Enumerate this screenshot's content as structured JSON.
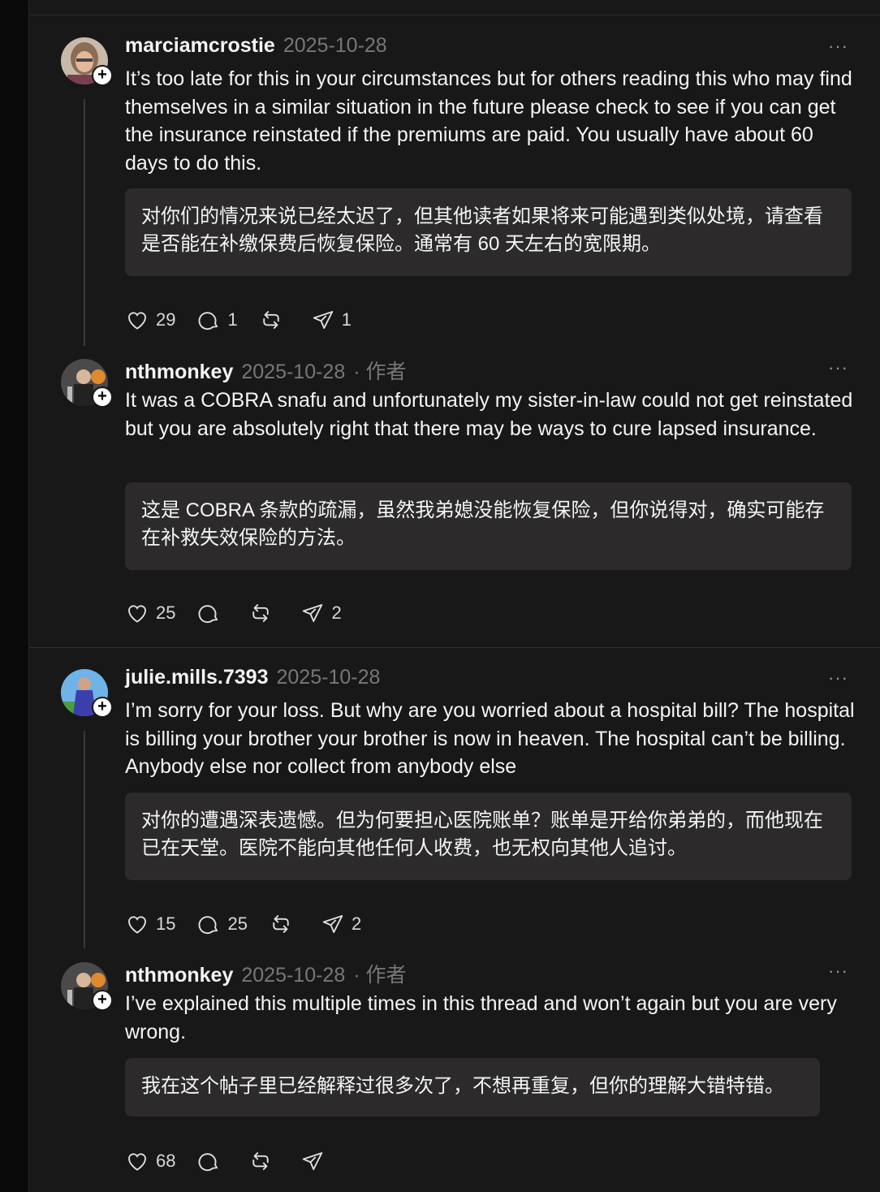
{
  "posts": [
    {
      "username": "marciamcrostie",
      "date": "2025-10-28",
      "author_tag": "",
      "more": "···",
      "text": "It’s too late for this in your circumstances but for others reading this who may find themselves in a similar situation in the future please check to see if you can get the insurance reinstated if the premiums are paid. You usually have about 60 days to do this.",
      "translation": "对你们的情况来说已经太迟了，但其他读者如果将来可能遇到类似处境，请查看是否能在补缴保费后恢复保险。通常有 60 天左右的宽限期。",
      "likes": "29",
      "replies": "1",
      "reposts": "",
      "shares": "1"
    },
    {
      "username": "nthmonkey",
      "date": "2025-10-28",
      "author_tag": "· 作者",
      "more": "···",
      "text": "It was a COBRA snafu and unfortunately my sister-in-law could not get reinstated but you are absolutely right that there may be ways to cure lapsed insurance.",
      "translation": "这是 COBRA 条款的疏漏，虽然我弟媳没能恢复保险，但你说得对，确实可能存在补救失效保险的方法。",
      "likes": "25",
      "replies": "",
      "reposts": "",
      "shares": "2"
    },
    {
      "username": "julie.mills.7393",
      "date": "2025-10-28",
      "author_tag": "",
      "more": "···",
      "text": "I’m sorry for your loss. But why are you worried about a hospital bill? The hospital is billing your brother your brother is now in heaven. The hospital can’t be billing. Anybody else nor collect from anybody else",
      "translation": "对你的遭遇深表遗憾。但为何要担心医院账单？账单是开给你弟弟的，而他现在已在天堂。医院不能向其他任何人收费，也无权向其他人追讨。",
      "likes": "15",
      "replies": "25",
      "reposts": "",
      "shares": "2"
    },
    {
      "username": "nthmonkey",
      "date": "2025-10-28",
      "author_tag": "· 作者",
      "more": "···",
      "text": "I’ve explained this multiple times in this thread and won’t again but you are very wrong.",
      "translation": "我在这个帖子里已经解释过很多次了，不想再重复，但你的理解大错特错。",
      "likes": "68",
      "replies": "",
      "reposts": "",
      "shares": ""
    }
  ],
  "icons": {
    "like": "heart-icon",
    "reply": "comment-icon",
    "repost": "repost-icon",
    "share": "send-icon",
    "follow": "plus-icon"
  }
}
